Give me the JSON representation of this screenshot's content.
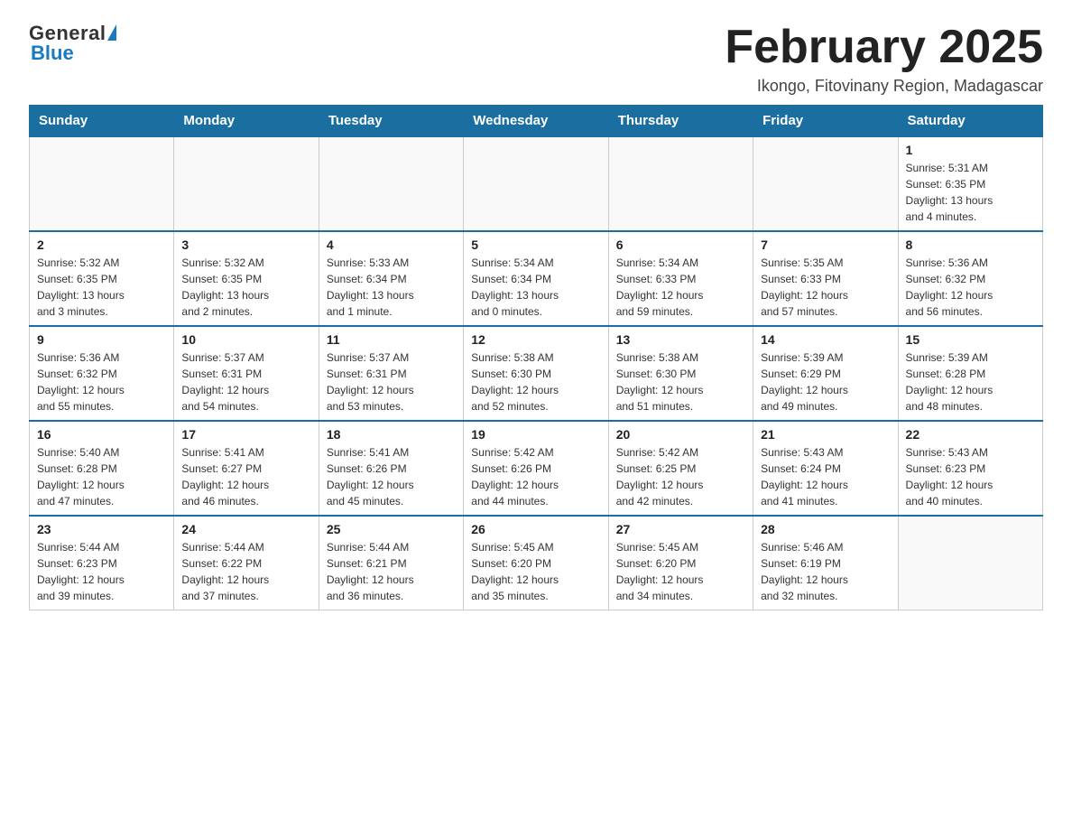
{
  "logo": {
    "general": "General",
    "blue": "Blue"
  },
  "title": "February 2025",
  "location": "Ikongo, Fitovinany Region, Madagascar",
  "days_of_week": [
    "Sunday",
    "Monday",
    "Tuesday",
    "Wednesday",
    "Thursday",
    "Friday",
    "Saturday"
  ],
  "weeks": [
    [
      {
        "day": "",
        "info": ""
      },
      {
        "day": "",
        "info": ""
      },
      {
        "day": "",
        "info": ""
      },
      {
        "day": "",
        "info": ""
      },
      {
        "day": "",
        "info": ""
      },
      {
        "day": "",
        "info": ""
      },
      {
        "day": "1",
        "info": "Sunrise: 5:31 AM\nSunset: 6:35 PM\nDaylight: 13 hours\nand 4 minutes."
      }
    ],
    [
      {
        "day": "2",
        "info": "Sunrise: 5:32 AM\nSunset: 6:35 PM\nDaylight: 13 hours\nand 3 minutes."
      },
      {
        "day": "3",
        "info": "Sunrise: 5:32 AM\nSunset: 6:35 PM\nDaylight: 13 hours\nand 2 minutes."
      },
      {
        "day": "4",
        "info": "Sunrise: 5:33 AM\nSunset: 6:34 PM\nDaylight: 13 hours\nand 1 minute."
      },
      {
        "day": "5",
        "info": "Sunrise: 5:34 AM\nSunset: 6:34 PM\nDaylight: 13 hours\nand 0 minutes."
      },
      {
        "day": "6",
        "info": "Sunrise: 5:34 AM\nSunset: 6:33 PM\nDaylight: 12 hours\nand 59 minutes."
      },
      {
        "day": "7",
        "info": "Sunrise: 5:35 AM\nSunset: 6:33 PM\nDaylight: 12 hours\nand 57 minutes."
      },
      {
        "day": "8",
        "info": "Sunrise: 5:36 AM\nSunset: 6:32 PM\nDaylight: 12 hours\nand 56 minutes."
      }
    ],
    [
      {
        "day": "9",
        "info": "Sunrise: 5:36 AM\nSunset: 6:32 PM\nDaylight: 12 hours\nand 55 minutes."
      },
      {
        "day": "10",
        "info": "Sunrise: 5:37 AM\nSunset: 6:31 PM\nDaylight: 12 hours\nand 54 minutes."
      },
      {
        "day": "11",
        "info": "Sunrise: 5:37 AM\nSunset: 6:31 PM\nDaylight: 12 hours\nand 53 minutes."
      },
      {
        "day": "12",
        "info": "Sunrise: 5:38 AM\nSunset: 6:30 PM\nDaylight: 12 hours\nand 52 minutes."
      },
      {
        "day": "13",
        "info": "Sunrise: 5:38 AM\nSunset: 6:30 PM\nDaylight: 12 hours\nand 51 minutes."
      },
      {
        "day": "14",
        "info": "Sunrise: 5:39 AM\nSunset: 6:29 PM\nDaylight: 12 hours\nand 49 minutes."
      },
      {
        "day": "15",
        "info": "Sunrise: 5:39 AM\nSunset: 6:28 PM\nDaylight: 12 hours\nand 48 minutes."
      }
    ],
    [
      {
        "day": "16",
        "info": "Sunrise: 5:40 AM\nSunset: 6:28 PM\nDaylight: 12 hours\nand 47 minutes."
      },
      {
        "day": "17",
        "info": "Sunrise: 5:41 AM\nSunset: 6:27 PM\nDaylight: 12 hours\nand 46 minutes."
      },
      {
        "day": "18",
        "info": "Sunrise: 5:41 AM\nSunset: 6:26 PM\nDaylight: 12 hours\nand 45 minutes."
      },
      {
        "day": "19",
        "info": "Sunrise: 5:42 AM\nSunset: 6:26 PM\nDaylight: 12 hours\nand 44 minutes."
      },
      {
        "day": "20",
        "info": "Sunrise: 5:42 AM\nSunset: 6:25 PM\nDaylight: 12 hours\nand 42 minutes."
      },
      {
        "day": "21",
        "info": "Sunrise: 5:43 AM\nSunset: 6:24 PM\nDaylight: 12 hours\nand 41 minutes."
      },
      {
        "day": "22",
        "info": "Sunrise: 5:43 AM\nSunset: 6:23 PM\nDaylight: 12 hours\nand 40 minutes."
      }
    ],
    [
      {
        "day": "23",
        "info": "Sunrise: 5:44 AM\nSunset: 6:23 PM\nDaylight: 12 hours\nand 39 minutes."
      },
      {
        "day": "24",
        "info": "Sunrise: 5:44 AM\nSunset: 6:22 PM\nDaylight: 12 hours\nand 37 minutes."
      },
      {
        "day": "25",
        "info": "Sunrise: 5:44 AM\nSunset: 6:21 PM\nDaylight: 12 hours\nand 36 minutes."
      },
      {
        "day": "26",
        "info": "Sunrise: 5:45 AM\nSunset: 6:20 PM\nDaylight: 12 hours\nand 35 minutes."
      },
      {
        "day": "27",
        "info": "Sunrise: 5:45 AM\nSunset: 6:20 PM\nDaylight: 12 hours\nand 34 minutes."
      },
      {
        "day": "28",
        "info": "Sunrise: 5:46 AM\nSunset: 6:19 PM\nDaylight: 12 hours\nand 32 minutes."
      },
      {
        "day": "",
        "info": ""
      }
    ]
  ]
}
